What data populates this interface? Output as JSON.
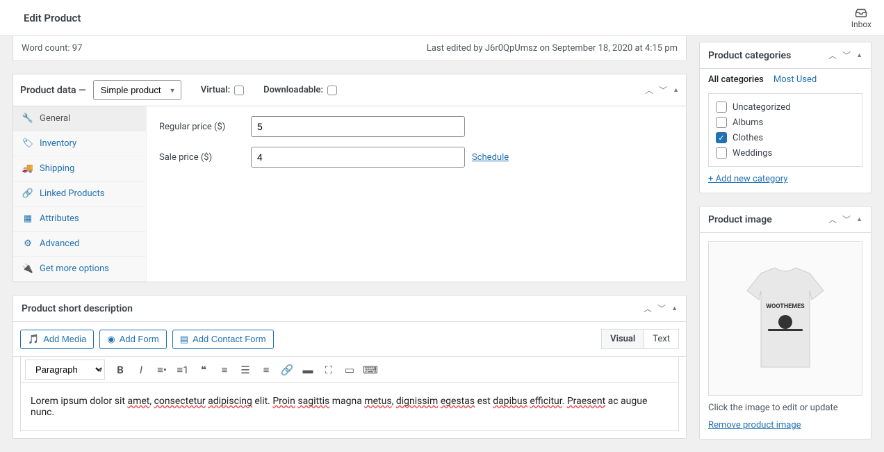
{
  "header": {
    "title": "Edit Product",
    "inbox": "Inbox"
  },
  "wordcount": "Word count: 97",
  "last_edited": "Last edited by J6r0QpUmsz on September 18, 2020 at 4:15 pm",
  "product_data": {
    "label": "Product data —",
    "type": "Simple product",
    "virtual_label": "Virtual:",
    "downloadable_label": "Downloadable:",
    "tabs": {
      "general": "General",
      "inventory": "Inventory",
      "shipping": "Shipping",
      "linked": "Linked Products",
      "attributes": "Attributes",
      "advanced": "Advanced",
      "more": "Get more options"
    },
    "regular_price_label": "Regular price ($)",
    "regular_price": "5",
    "sale_price_label": "Sale price ($)",
    "sale_price": "4",
    "schedule": "Schedule"
  },
  "short_desc": {
    "title": "Product short description",
    "add_media": "Add Media",
    "add_form": "Add Form",
    "add_contact": "Add Contact Form",
    "visual": "Visual",
    "text": "Text",
    "paragraph": "Paragraph",
    "content_parts": {
      "p1": "Lorem ipsum dolor sit ",
      "s1": "amet",
      "p2": ", ",
      "s2": "consectetur",
      "p3": " ",
      "s3": "adipiscing",
      "p4": " elit. ",
      "s4": "Proin",
      "p5": " ",
      "s5": "sagittis",
      "p6": " magna ",
      "s6": "metus",
      "p7": ", ",
      "s7": "dignissim",
      "p8": " ",
      "s8": "egestas",
      "p9": " est ",
      "s9": "dapibus",
      "p10": " ",
      "s10": "efficitur",
      "p11": ". ",
      "s11": "Praesent",
      "p12": " ac augue nunc."
    }
  },
  "categories": {
    "title": "Product categories",
    "all": "All categories",
    "most_used": "Most Used",
    "items": {
      "uncategorized": "Uncategorized",
      "albums": "Albums",
      "clothes": "Clothes",
      "weddings": "Weddings"
    },
    "add_new": "+ Add new category"
  },
  "product_image": {
    "title": "Product image",
    "caption": "Click the image to edit or update",
    "remove": "Remove product image",
    "shirt_text": "WOOTHEMES"
  }
}
